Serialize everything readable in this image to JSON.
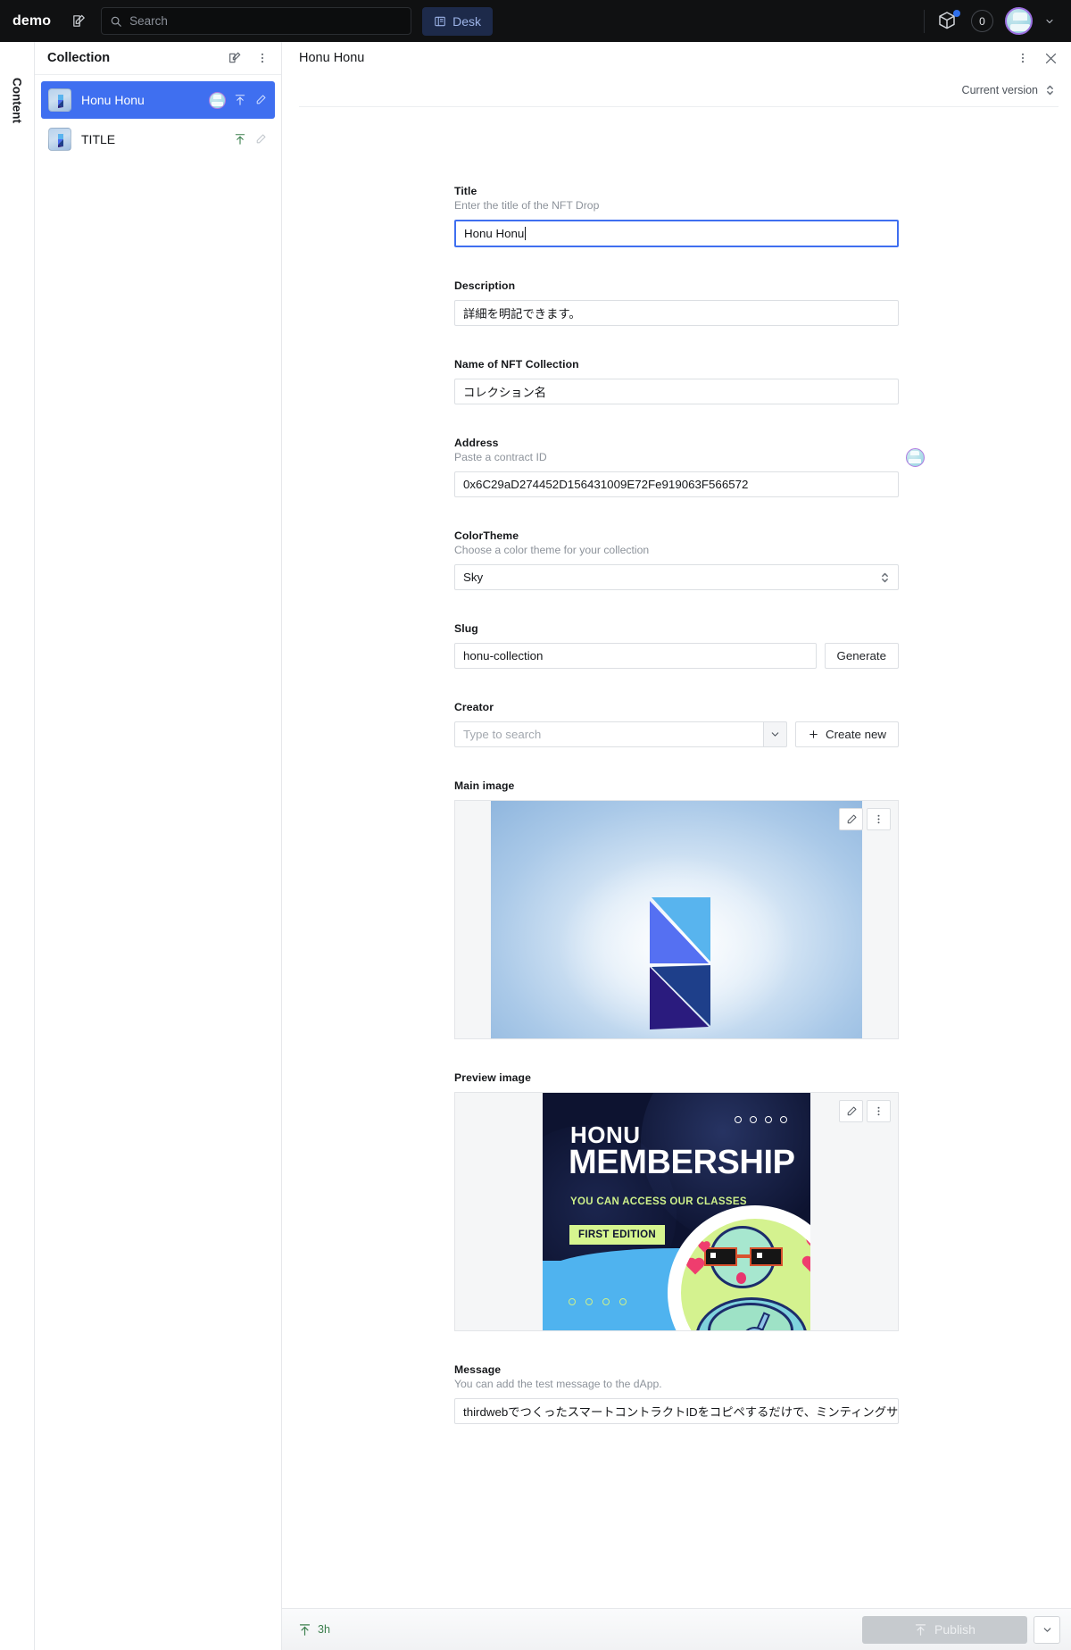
{
  "topnav": {
    "brand": "demo",
    "compose_icon": "compose-icon",
    "search": {
      "placeholder": "Search",
      "icon": "search-icon"
    },
    "desk_button": {
      "label": "Desk",
      "icon": "desk-icon"
    },
    "package_icon": "package-icon",
    "notification_count": "0",
    "avatar_icon": "user-avatar",
    "chevron_icon": "chevron-down-icon"
  },
  "rail": {
    "label": "Content"
  },
  "pane": {
    "title": "Collection",
    "edit_icon": "compose-icon",
    "menu_icon": "ellipsis-vertical-icon",
    "documents": [
      {
        "name": "Honu Honu",
        "selected": true,
        "has_avatar": true,
        "publish_icon": "publish-up-icon",
        "edit_icon": "pencil-icon"
      },
      {
        "name": "TITLE",
        "selected": false,
        "has_avatar": false,
        "publish_icon": "publish-up-icon",
        "edit_icon": "pencil-icon"
      }
    ]
  },
  "document": {
    "title": "Honu Honu",
    "menu_icon": "ellipsis-vertical-icon",
    "close_icon": "close-icon",
    "version_label": "Current version",
    "version_stepper_icon": "stepper-updown-icon"
  },
  "form": {
    "title_field": {
      "label": "Title",
      "description": "Enter the title of the NFT Drop",
      "value": "Honu Honu",
      "focused": true
    },
    "description_field": {
      "label": "Description",
      "value": "詳細を明記できます。"
    },
    "collection_name_field": {
      "label": "Name of NFT Collection",
      "value": "コレクション名"
    },
    "address_field": {
      "label": "Address",
      "description": "Paste a contract ID",
      "value": "0x6C29aD274452D156431009E72Fe919063F566572",
      "avatar_icon": "user-avatar"
    },
    "colortheme_field": {
      "label": "ColorTheme",
      "description": "Choose a color theme for your collection",
      "value": "Sky",
      "stepper_icon": "stepper-updown-icon",
      "options": [
        "Sky"
      ]
    },
    "slug_field": {
      "label": "Slug",
      "value": "honu-collection",
      "button_label": "Generate"
    },
    "creator_field": {
      "label": "Creator",
      "placeholder": "Type to search",
      "chevron_icon": "chevron-down-icon",
      "create_label": "Create new",
      "create_icon": "plus-icon"
    },
    "main_image_field": {
      "label": "Main image",
      "edit_icon": "pencil-icon",
      "menu_icon": "ellipsis-vertical-icon"
    },
    "preview_image_field": {
      "label": "Preview image",
      "edit_icon": "pencil-icon",
      "menu_icon": "ellipsis-vertical-icon",
      "artwork": {
        "brand": "HONU",
        "headline": "MEMBERSHIP",
        "subline": "YOU CAN ACCESS OUR CLASSES",
        "badge": "FIRST EDITION"
      }
    },
    "message_field": {
      "label": "Message",
      "description": "You can add the test message to the dApp.",
      "value": "thirdwebでつくったスマートコントラクトIDをコピペするだけで、ミンティングサイト"
    }
  },
  "bottombar": {
    "status_icon": "publish-up-icon",
    "status_text": "3h",
    "publish_label": "Publish",
    "publish_icon": "publish-up-icon",
    "caret_icon": "chevron-down-icon"
  },
  "colors": {
    "accent": "#3f6ff0",
    "topnav_bg": "#101112",
    "desk_btn_bg": "#1d2a4a",
    "publish_green": "#3b7f4d",
    "preview_dark": "#0d1330",
    "preview_lime": "#d6f58f"
  }
}
